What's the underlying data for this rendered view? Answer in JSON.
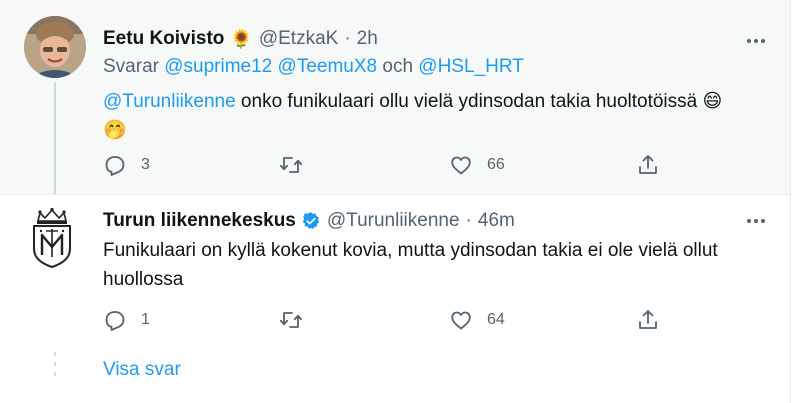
{
  "tweets": [
    {
      "name": "Eetu Koivisto",
      "name_emoji": "🌻",
      "handle": "@EtzkaK",
      "separator": "·",
      "time": "2h",
      "replying_label": "Svarar",
      "replying_mentions": [
        "@suprime12",
        "@TeemuX8"
      ],
      "replying_conj": "och",
      "replying_last": "@HSL_HRT",
      "text_mention": "@Turunliikenne",
      "text_body": " onko funikulaari ollu vielä ydinsodan takia huoltotöissä ",
      "text_emoji1": "😄",
      "text_emoji2": "🤭",
      "reply_count": "3",
      "retweet_count": "",
      "like_count": "66"
    },
    {
      "name": "Turun liikennekeskus",
      "verified": true,
      "handle": "@Turunliikenne",
      "separator": "·",
      "time": "46m",
      "text_line1": "Funikulaari on kyllä kokenut kovia, mutta ydinsodan takia ei ole vielä ollut",
      "text_line2": "huollossa",
      "reply_count": "1",
      "retweet_count": "",
      "like_count": "64"
    }
  ],
  "show_replies_label": "Visa svar",
  "colors": {
    "link": "#1d9bf0",
    "muted": "#536471",
    "text": "#0f1419",
    "highlight_bg": "#f7f9f9",
    "verified": "#1d9bf0"
  }
}
